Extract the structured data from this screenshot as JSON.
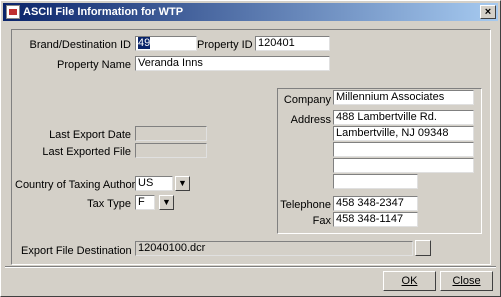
{
  "window": {
    "title": "ASCII File Information for WTP"
  },
  "form": {
    "brand_label": "Brand/Destination ID",
    "brand_value": "49",
    "property_id_label": "Property ID",
    "property_id_value": "120401",
    "property_name_label": "Property Name",
    "property_name_value": "Veranda Inns",
    "last_export_date_label": "Last Export Date",
    "last_export_date_value": "",
    "last_exported_file_label": "Last Exported File",
    "last_exported_file_value": "",
    "country_label": "Country of Taxing Authority",
    "country_value": "US",
    "tax_type_label": "Tax Type",
    "tax_type_value": "F",
    "export_dest_label": "Export File Destination",
    "export_dest_value": "12040100.dcr"
  },
  "company": {
    "company_label": "Company",
    "company_value": "Millennium  Associates",
    "address_label": "Address",
    "address_lines": [
      "488 Lambertville Rd.",
      "Lambertville, NJ 09348",
      "",
      ""
    ],
    "address_extra": "",
    "telephone_label": "Telephone",
    "telephone_value": "458 348-2347",
    "fax_label": "Fax",
    "fax_value": "458 348-1147"
  },
  "buttons": {
    "ok_label": "OK",
    "close_label": "Close"
  },
  "icons": {
    "dropdown": "down-arrow-icon",
    "browse": "browse-icon",
    "app": "app-icon"
  }
}
